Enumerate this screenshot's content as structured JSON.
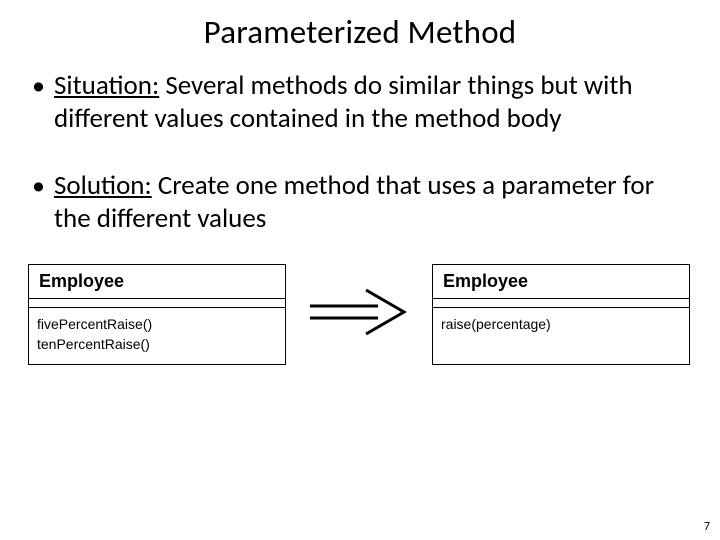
{
  "title": "Parameterized Method",
  "bullets": [
    {
      "label": "Situation:",
      "text": " Several methods do similar things but with different values contained in the method body"
    },
    {
      "label": "Solution:",
      "text": " Create one method that uses a parameter for the different values"
    }
  ],
  "uml_left": {
    "class_name": "Employee",
    "methods": [
      "fivePercentRaise()",
      "tenPercentRaise()"
    ]
  },
  "uml_right": {
    "class_name": "Employee",
    "methods": [
      "raise(percentage)"
    ]
  },
  "page_number": "7"
}
